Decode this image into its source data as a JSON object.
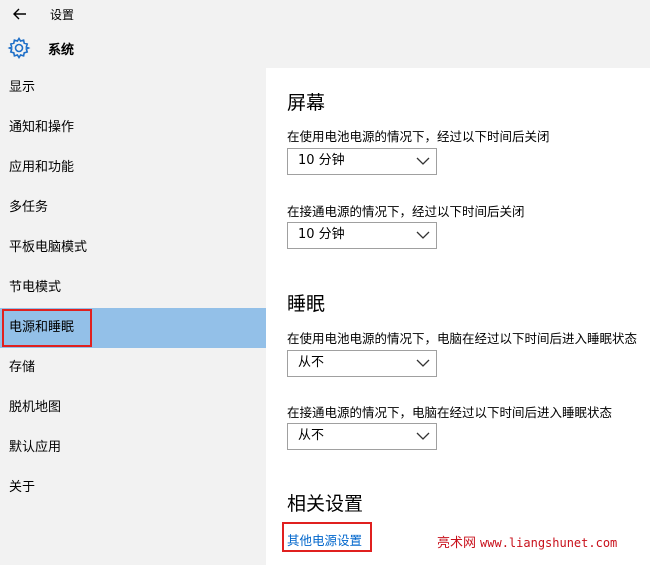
{
  "titlebar": {
    "title": "设置"
  },
  "header": {
    "title": "系统"
  },
  "sidebar": {
    "items": [
      {
        "label": "显示"
      },
      {
        "label": "通知和操作"
      },
      {
        "label": "应用和功能"
      },
      {
        "label": "多任务"
      },
      {
        "label": "平板电脑模式"
      },
      {
        "label": "节电模式"
      },
      {
        "label": "电源和睡眠",
        "active": true
      },
      {
        "label": "存储"
      },
      {
        "label": "脱机地图"
      },
      {
        "label": "默认应用"
      },
      {
        "label": "关于"
      }
    ]
  },
  "screen": {
    "title": "屏幕",
    "battery_label": "在使用电池电源的情况下，经过以下时间后关闭",
    "battery_value": "10 分钟",
    "plugged_label": "在接通电源的情况下，经过以下时间后关闭",
    "plugged_value": "10 分钟"
  },
  "sleep": {
    "title": "睡眠",
    "battery_label": "在使用电池电源的情况下，电脑在经过以下时间后进入睡眠状态",
    "battery_value": "从不",
    "plugged_label": "在接通电源的情况下，电脑在经过以下时间后进入睡眠状态",
    "plugged_value": "从不"
  },
  "related": {
    "title": "相关设置",
    "link": "其他电源设置"
  },
  "watermark": {
    "name": "亮术网",
    "url": "www.liangshunet.com"
  },
  "colors": {
    "accent": "#0066cc",
    "active_bg": "#93c0e8",
    "highlight": "#e0201f",
    "watermark": "#c8101b"
  }
}
